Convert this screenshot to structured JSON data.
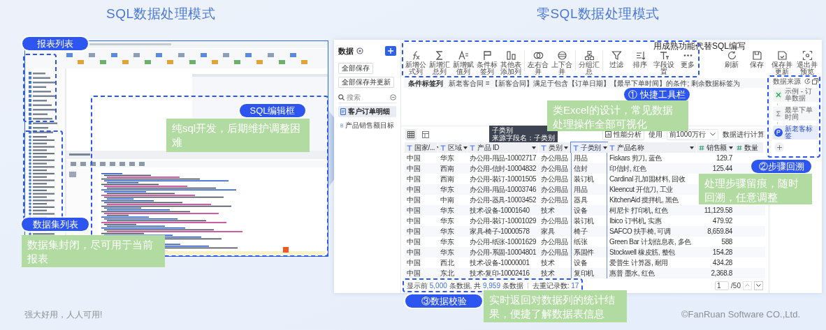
{
  "sql_mode": {
    "title": "SQL数据处理模式",
    "labels": [
      "报表列表",
      "SQL编辑框",
      "数据集列表"
    ],
    "notes": [
      "纯sql开发，后期维护调整困难",
      "数据集封闭，尽可用于当前报表"
    ]
  },
  "no_sql_mode": {
    "title": "零SQL数据处理模式",
    "headline": "用成熟功能代替SQL编写",
    "sidebar": {
      "title": "数据",
      "buttons": [
        "全部保存",
        "全部保存并更新"
      ],
      "search": {
        "placeholder": "搜索"
      },
      "items": [
        {
          "label": "客户订单明细",
          "selected": true
        },
        {
          "label": "产品销售额目标",
          "selected": false
        }
      ]
    },
    "toolbar": {
      "tools": [
        "新增公式列",
        "新增汇总列",
        "新增赋值列",
        "条件标签列",
        "其他表添加列",
        "左右合并",
        "上下合并",
        "分组汇总",
        "过滤",
        "排序",
        "字段设置",
        "更多"
      ],
      "actions": [
        "刷新",
        "保存",
        "保存并更新",
        "退出并预览"
      ]
    },
    "formula_bar": {
      "label": "条件标签列",
      "text": "新老客合同 = 【新客合同】满足于包含【订单日期】【最早下单时间】的条件; 剩余数据标签为"
    },
    "grid_toolbar": {
      "analysis_button": "性能分析",
      "use_label": "使用",
      "row_limit": "前1000万行",
      "compute_label": "数据进行计算"
    },
    "tooltip": {
      "title": "子类别",
      "text": "来源字段名：子类别"
    },
    "table": {
      "columns": [
        {
          "label": "国家/...",
          "kind": "text",
          "selected": false
        },
        {
          "label": "区域",
          "kind": "text",
          "selected": false
        },
        {
          "label": "产品 ID",
          "kind": "text",
          "selected": false
        },
        {
          "label": "类别",
          "kind": "text",
          "selected": false
        },
        {
          "label": "子类别",
          "kind": "text",
          "selected": true
        },
        {
          "label": "产品名称",
          "kind": "text",
          "selected": false
        },
        {
          "label": "销售额",
          "kind": "number",
          "selected": false
        },
        {
          "label": "数量",
          "kind": "number",
          "selected": false
        }
      ],
      "rows": [
        [
          "中国",
          "华东",
          "办公用-用品-10002717",
          "办公用品",
          "用品",
          "Fiskars 剪刀, 蓝色",
          "129.7"
        ],
        [
          "中国",
          "西南",
          "办公用-信封-10004832",
          "办公用品",
          "信封",
          "印信封, 红色",
          "125.44"
        ],
        [
          "中国",
          "西南",
          "办公用-装订-10001505",
          "办公用品",
          "装订机",
          "Cardinal 孔加固材料, 回收"
        ],
        [
          "中国",
          "华东",
          "办公用-用品-10003746",
          "办公用品",
          "用品",
          "Kleencut 开信刀, 工业"
        ],
        [
          "中国",
          "中南",
          "办公用-器具-10003452",
          "办公用品",
          "器具",
          "KitchenAid 搅拌机, 黑色"
        ],
        [
          "中国",
          "华东",
          "技术-设备-10001640",
          "技术",
          "设备",
          "柯尼卡 打印机, 红色",
          "11,129.58"
        ],
        [
          "中国",
          "华东",
          "办公用-装订-10001029",
          "办公用品",
          "装订机",
          "Ibico 订书机, 实惠",
          "479.92"
        ],
        [
          "中国",
          "华东",
          "家具-椅子-10000578",
          "家具",
          "椅子",
          "SAFCO 扶手椅, 可调",
          "8,659.84"
        ],
        [
          "中国",
          "华东",
          "办公用-纸张-10001629",
          "办公用品",
          "纸张",
          "Green Bar 计划信息表, 多色",
          "588"
        ],
        [
          "中国",
          "华东",
          "办公用-系固-10004801",
          "办公用品",
          "系固件",
          "Stockwell 橡皮筋, 整包",
          "154.28"
        ],
        [
          "中国",
          "西北",
          "技术-设备-10000001",
          "技术",
          "设备",
          "爱普生 计算器, 耐用",
          "434.28"
        ],
        [
          "中国",
          "东北",
          "技术-复印-10002416",
          "技术",
          "复印机",
          "惠普 墨水, 红色",
          "2,368.8"
        ]
      ]
    },
    "footer": {
      "parts": [
        {
          "text": "显示前 ",
          "kind": "plain"
        },
        {
          "text": "5,000",
          "kind": "count"
        },
        {
          "text": " 条数据, 共 ",
          "kind": "plain"
        },
        {
          "text": "9,959",
          "kind": "count"
        },
        {
          "text": " 条数据",
          "kind": "plain"
        }
      ],
      "distinct_label": "去重记录数:",
      "distinct": "17",
      "page": "1",
      "pages": "/50"
    },
    "steps": {
      "title": "数据来源",
      "items": [
        {
          "label": "示例 - 订单数据",
          "kind": "source",
          "selected": false
        },
        {
          "label": "最早下单时间",
          "kind": "sum",
          "selected": false
        },
        {
          "label": "新老客标签",
          "kind": "tag",
          "selected": true
        }
      ]
    },
    "labels": [
      "① 快捷工具栏",
      "②步骤回溯",
      "③数据校验"
    ],
    "notes": [
      "类Excel的设计，常见数据处理操作全部可视化",
      "处理步骤留痕，随时回溯，任意调整",
      "实时返回对数据列的统计结果，便捷了解数据表信息"
    ]
  },
  "footer": {
    "slogan": "强大好用，人人可用!",
    "copyright": "©FanRuan Software CO.,Ltd."
  }
}
